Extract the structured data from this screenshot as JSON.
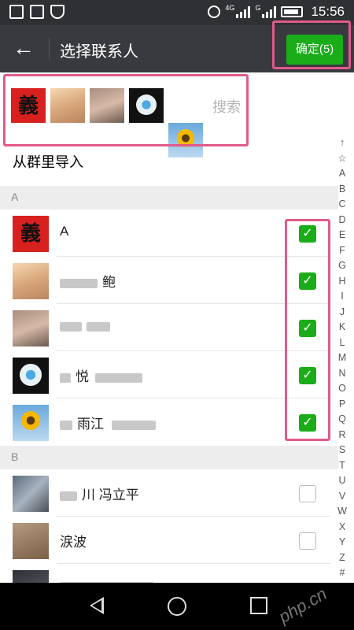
{
  "status_bar": {
    "network": "4G",
    "network2": "G",
    "time": "15:56"
  },
  "header": {
    "title": "选择联系人",
    "confirm_label": "确定(5)"
  },
  "selected": {
    "avatars": [
      "yi-avatar",
      "woman-avatar",
      "man-avatar",
      "astronaut-avatar",
      "sunflower-avatar"
    ],
    "search_placeholder": "搜索"
  },
  "import_from_group": "从群里导入",
  "sections": [
    {
      "letter": "A",
      "contacts": [
        {
          "name": "A",
          "checked": true
        },
        {
          "name": "",
          "name_suffix": "鲍",
          "checked": true
        },
        {
          "name": "",
          "checked": true
        },
        {
          "name": "",
          "name_suffix": "悦",
          "checked": true
        },
        {
          "name": "",
          "name_suffix": "雨江",
          "checked": true
        }
      ]
    },
    {
      "letter": "B",
      "contacts": [
        {
          "name": "",
          "name_suffix": "川 冯立平",
          "checked": false
        },
        {
          "name": "",
          "name_suffix": "涙波",
          "checked": false
        }
      ]
    }
  ],
  "index_letters": [
    "↑",
    "☆",
    "A",
    "B",
    "C",
    "D",
    "E",
    "F",
    "G",
    "H",
    "I",
    "J",
    "K",
    "L",
    "M",
    "N",
    "O",
    "P",
    "Q",
    "R",
    "S",
    "T",
    "U",
    "V",
    "W",
    "X",
    "Y",
    "Z",
    "#"
  ],
  "watermark": "php.cn"
}
